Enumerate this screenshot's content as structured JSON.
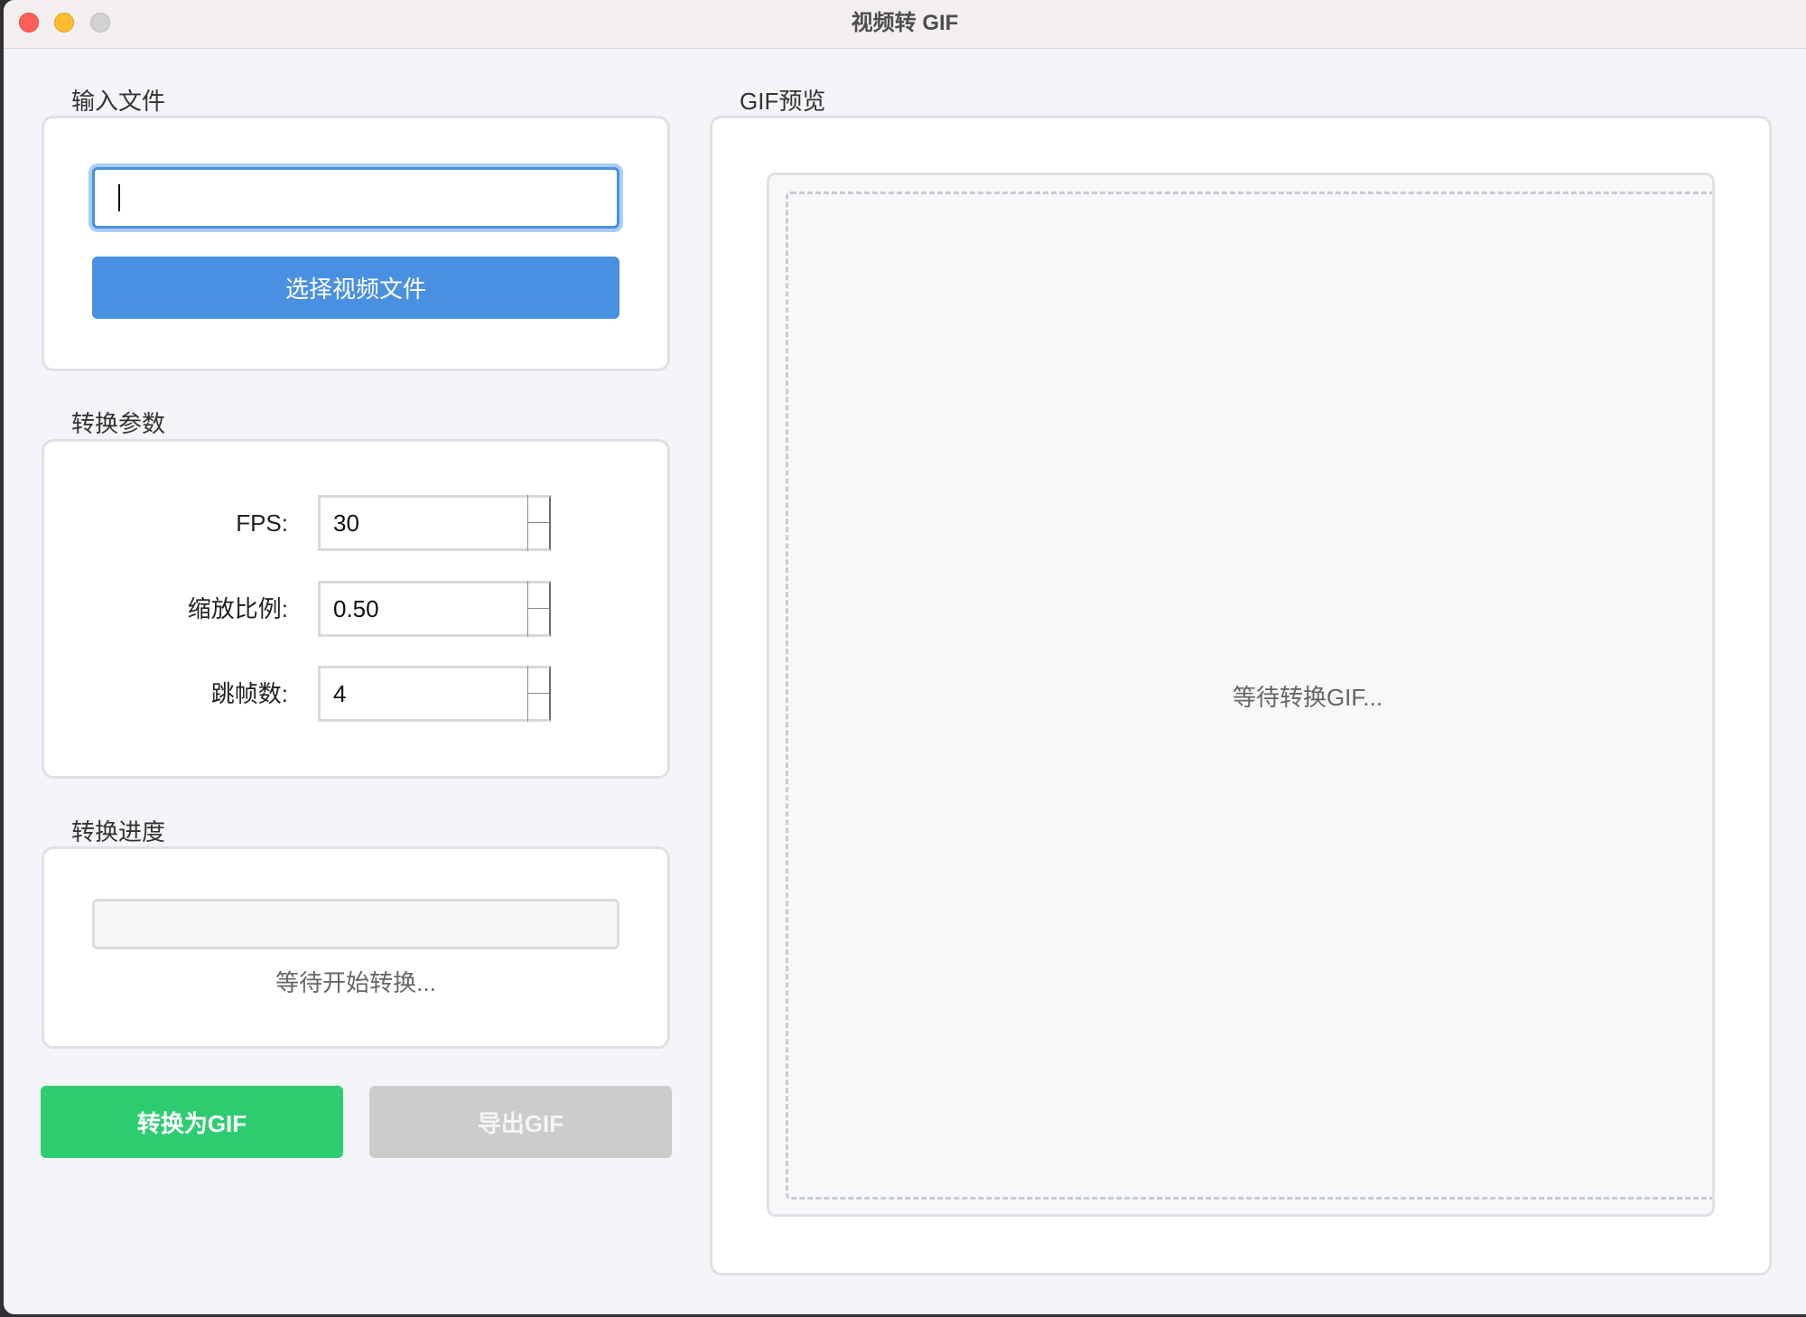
{
  "window": {
    "title": "视频转 GIF"
  },
  "input_group": {
    "title": "输入文件",
    "file_path": "",
    "select_button": "选择视频文件"
  },
  "params_group": {
    "title": "转换参数",
    "fps": {
      "label": "FPS:",
      "value": "30"
    },
    "scale": {
      "label": "缩放比例:",
      "value": "0.50"
    },
    "skip": {
      "label": "跳帧数:",
      "value": "4"
    }
  },
  "progress_group": {
    "title": "转换进度",
    "value": 0,
    "status": "等待开始转换..."
  },
  "actions": {
    "convert": "转换为GIF",
    "export": "导出GIF"
  },
  "preview_group": {
    "title": "GIF预览",
    "placeholder": "等待转换GIF..."
  },
  "colors": {
    "accent": "#4a90e2",
    "accent_ring": "#a9cdf7",
    "success": "#2ecc71",
    "disabled": "#cccccc"
  }
}
